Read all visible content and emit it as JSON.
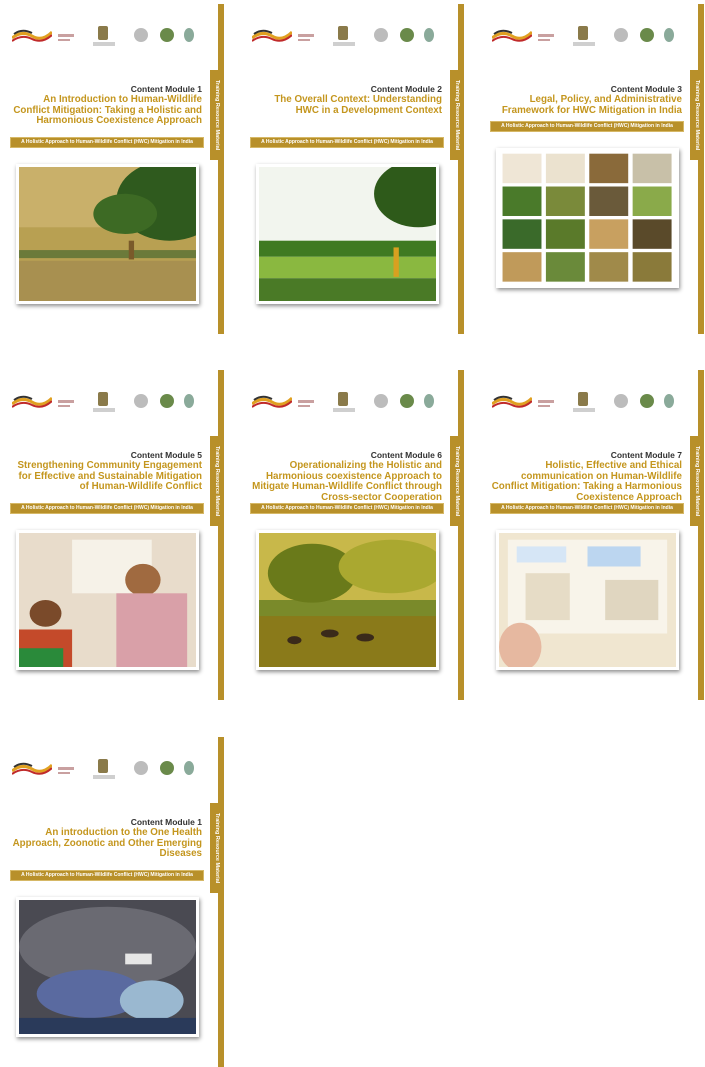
{
  "covers": [
    {
      "module_label": "Content Module 1",
      "title": "An Introduction to Human-Wildlife Conflict Mitigation: Taking a Holistic and Harmonious Coexistence Approach",
      "series": "A Holistic Approach to Human-Wildlife Conflict (HWC) Mitigation in India",
      "spine": "Training Resource Material",
      "photo_icon": "landscape-photo"
    },
    {
      "module_label": "Content Module 2",
      "title": "The Overall Context: Understanding HWC in a Development Context",
      "series": "A Holistic Approach to Human-Wildlife Conflict (HWC) Mitigation in India",
      "spine": "Training Resource Material",
      "photo_icon": "landscape-photo"
    },
    {
      "module_label": "Content Module 3",
      "title": "Legal, Policy, and Administrative Framework for HWC Mitigation in India",
      "series": "A Holistic Approach to Human-Wildlife Conflict (HWC) Mitigation in India",
      "spine": "Training Resource Material",
      "photo_icon": "collage-photo"
    },
    {
      "module_label": "Content Module 5",
      "title": "Strengthening Community Engagement for Effective and Sustainable Mitigation of Human-Wildlife Conflict",
      "series": "A Holistic Approach to Human-Wildlife Conflict (HWC) Mitigation in India",
      "spine": "Training Resource Material",
      "photo_icon": "people-photo"
    },
    {
      "module_label": "Content Module 6",
      "title": "Operationalizing the Holistic and Harmonious coexistence Approach to Mitigate Human-Wildlife Conflict through Cross-sector Cooperation",
      "series": "A Holistic Approach to Human-Wildlife Conflict (HWC) Mitigation in India",
      "spine": "Training Resource Material",
      "photo_icon": "cattle-photo"
    },
    {
      "module_label": "Content Module 7",
      "title": "Holistic, Effective and Ethical communication on Human-Wildlife Conflict Mitigation: Taking a Harmonious Coexistence Approach",
      "series": "A Holistic Approach to Human-Wildlife Conflict (HWC) Mitigation in India",
      "spine": "Training Resource Material",
      "photo_icon": "media-board-photo"
    },
    {
      "module_label": "Content Module 1",
      "title": "An introduction to the One Health Approach, Zoonotic and Other Emerging Diseases",
      "series": "A Holistic Approach to Human-Wildlife Conflict (HWC) Mitigation in India",
      "spine": "Training Resource Material",
      "photo_icon": "vet-elephant-photo"
    }
  ],
  "colors": {
    "accent": "#b8902a",
    "title": "#c4961e"
  }
}
